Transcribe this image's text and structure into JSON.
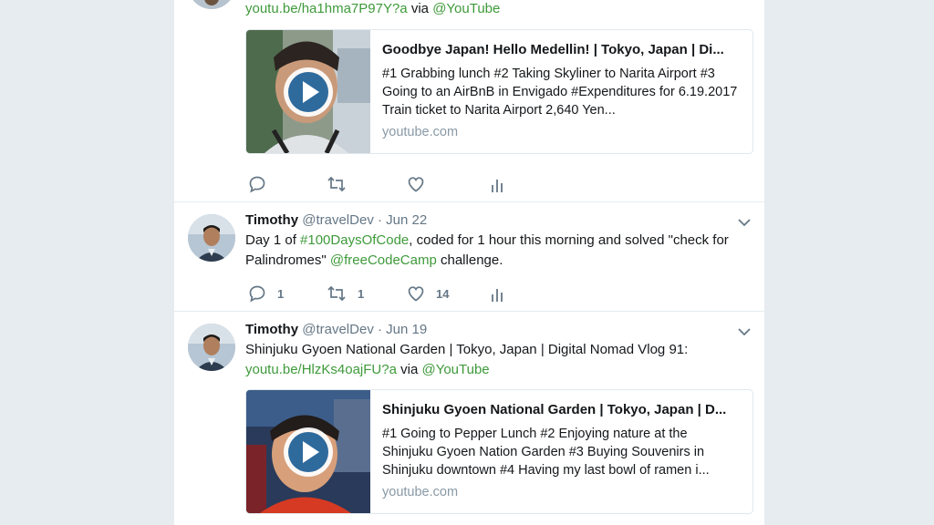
{
  "tweets": [
    {
      "link_text": "youtu.be/ha1hma7P97Y?a",
      "via_text": "via",
      "via_handle": "@YouTube",
      "card": {
        "title": "Goodbye Japan! Hello Medellin! | Tokyo, Japan | Di...",
        "description": "#1 Grabbing lunch #2 Taking Skyliner to Narita Airport #3 Going to an AirBnB in Envigado #Expenditures for 6.19.2017 Train ticket to Narita Airport 2,640 Yen...",
        "domain": "youtube.com"
      },
      "actions": {
        "reply": "",
        "retweet": "",
        "like": ""
      }
    },
    {
      "name": "Timothy",
      "handle": "@travelDev",
      "dot": "·",
      "date": "Jun 22",
      "text_parts": [
        "Day 1 of ",
        "#100DaysOfCode",
        ", coded for 1 hour this morning and solved \"check for Palindromes\" ",
        "@freeCodeCamp",
        " challenge."
      ],
      "actions": {
        "reply": "1",
        "retweet": "1",
        "like": "14"
      }
    },
    {
      "name": "Timothy",
      "handle": "@travelDev",
      "dot": "·",
      "date": "Jun 19",
      "text": "Shinjuku Gyoen National Garden | Tokyo, Japan | Digital Nomad Vlog 91:",
      "link_text": "youtu.be/HlzKs4oajFU?a",
      "via_text": "via",
      "via_handle": "@YouTube",
      "card": {
        "title": "Shinjuku Gyoen National Garden | Tokyo, Japan | D...",
        "description": "#1 Going to Pepper Lunch #2 Enjoying nature at the Shinjuku Gyoen Nation Garden #3 Buying Souvenirs in Shinjuku downtown #4 Having my last bowl of ramen i...",
        "domain": "youtube.com"
      }
    }
  ],
  "colors": {
    "link": "#3e9a3a",
    "muted": "#657786",
    "background": "#e6ecf0"
  },
  "icons": [
    "reply-icon",
    "retweet-icon",
    "like-icon",
    "analytics-icon",
    "chevron-down-icon",
    "play-icon"
  ]
}
